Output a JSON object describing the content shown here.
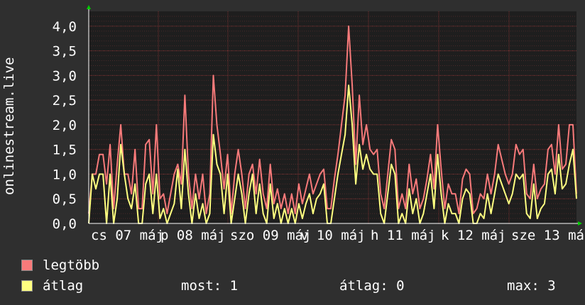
{
  "chart_data": {
    "type": "line",
    "ylabel": "onlinestream.live",
    "ylim": [
      0,
      4.3
    ],
    "yticks": [
      "0,0",
      "0,5",
      "1,0",
      "1,5",
      "2,0",
      "2,5",
      "3,0",
      "3,5",
      "4,0"
    ],
    "xticks": [
      "cs 07 máj",
      "p 08 máj",
      "szo 09 máj",
      "v 10 máj",
      "h 11 máj",
      "k 12 máj",
      "sze 13 máj"
    ],
    "grid": true,
    "series": [
      {
        "name": "legtöbb",
        "color": "#f87a7a",
        "values": [
          0.2,
          1.0,
          1.0,
          1.4,
          1.4,
          0.8,
          1.6,
          0.3,
          1.2,
          2.0,
          1.0,
          1.0,
          0.6,
          1.5,
          0.3,
          0.3,
          1.6,
          1.7,
          0.6,
          2.0,
          0.5,
          0.6,
          0.2,
          0.6,
          1.0,
          1.2,
          0.8,
          2.6,
          1.0,
          0.3,
          1.0,
          0.5,
          1.0,
          0.2,
          0.6,
          3.0,
          2.0,
          1.4,
          0.7,
          1.4,
          0.2,
          1.0,
          1.5,
          1.0,
          0.3,
          1.0,
          1.2,
          0.6,
          1.3,
          0.6,
          0.3,
          1.2,
          0.4,
          0.7,
          0.3,
          0.6,
          0.2,
          0.6,
          0.2,
          0.8,
          0.4,
          0.7,
          1.0,
          0.6,
          0.8,
          1.0,
          1.1,
          0.3,
          0.3,
          0.9,
          1.4,
          2.0,
          2.6,
          4.0,
          2.8,
          1.2,
          2.6,
          1.6,
          2.0,
          1.5,
          1.4,
          1.5,
          0.6,
          0.3,
          1.0,
          1.7,
          1.5,
          0.3,
          0.6,
          0.3,
          1.2,
          0.6,
          0.9,
          0.3,
          0.5,
          0.9,
          1.4,
          0.7,
          2.0,
          1.1,
          0.3,
          0.8,
          0.6,
          0.6,
          0.2,
          0.9,
          1.1,
          1.0,
          0.2,
          0.3,
          0.6,
          0.5,
          1.0,
          0.6,
          1.0,
          1.6,
          1.3,
          1.0,
          0.8,
          1.0,
          1.6,
          1.4,
          1.5,
          0.6,
          0.5,
          1.2,
          0.5,
          0.7,
          0.8,
          1.5,
          1.6,
          1.0,
          2.0,
          1.1,
          1.2,
          2.0,
          2.0,
          0.6
        ]
      },
      {
        "name": "átlag",
        "color": "#ffff80",
        "values": [
          0.0,
          1.0,
          0.7,
          1.0,
          1.0,
          0.0,
          1.0,
          0.0,
          0.5,
          1.6,
          1.0,
          0.5,
          0.3,
          0.8,
          0.0,
          0.0,
          0.8,
          1.0,
          0.2,
          1.0,
          0.1,
          0.3,
          0.0,
          0.2,
          0.4,
          1.1,
          0.3,
          1.5,
          0.6,
          0.0,
          0.6,
          0.1,
          0.4,
          0.0,
          0.2,
          1.8,
          1.2,
          1.0,
          0.2,
          1.0,
          0.0,
          0.5,
          1.0,
          0.6,
          0.0,
          0.6,
          1.0,
          0.2,
          0.8,
          0.2,
          0.0,
          0.8,
          0.1,
          0.4,
          0.0,
          0.3,
          0.0,
          0.3,
          0.0,
          0.4,
          0.1,
          0.4,
          0.6,
          0.2,
          0.5,
          0.6,
          0.8,
          0.0,
          0.0,
          0.5,
          1.0,
          1.4,
          1.8,
          2.8,
          2.0,
          0.8,
          1.6,
          1.1,
          1.4,
          1.1,
          1.0,
          1.0,
          0.2,
          0.0,
          0.6,
          1.2,
          1.0,
          0.0,
          0.2,
          0.0,
          0.7,
          0.2,
          0.5,
          0.0,
          0.2,
          0.6,
          1.0,
          0.3,
          1.4,
          0.6,
          0.0,
          0.4,
          0.2,
          0.2,
          0.0,
          0.5,
          0.7,
          0.6,
          0.0,
          0.0,
          0.2,
          0.1,
          0.6,
          0.2,
          0.6,
          1.0,
          0.8,
          0.6,
          0.4,
          0.6,
          1.0,
          0.9,
          1.0,
          0.2,
          0.1,
          0.8,
          0.1,
          0.3,
          0.4,
          1.0,
          1.1,
          0.6,
          1.4,
          0.7,
          0.8,
          1.2,
          1.5,
          0.5
        ]
      }
    ]
  },
  "legend": {
    "max_label": "legtöbb",
    "avg_label": "átlag",
    "max_color": "#f87a7a",
    "avg_color": "#ffff80"
  },
  "stats": {
    "now": "most: 1",
    "avg": "átlag: 0",
    "max": "max: 3"
  }
}
